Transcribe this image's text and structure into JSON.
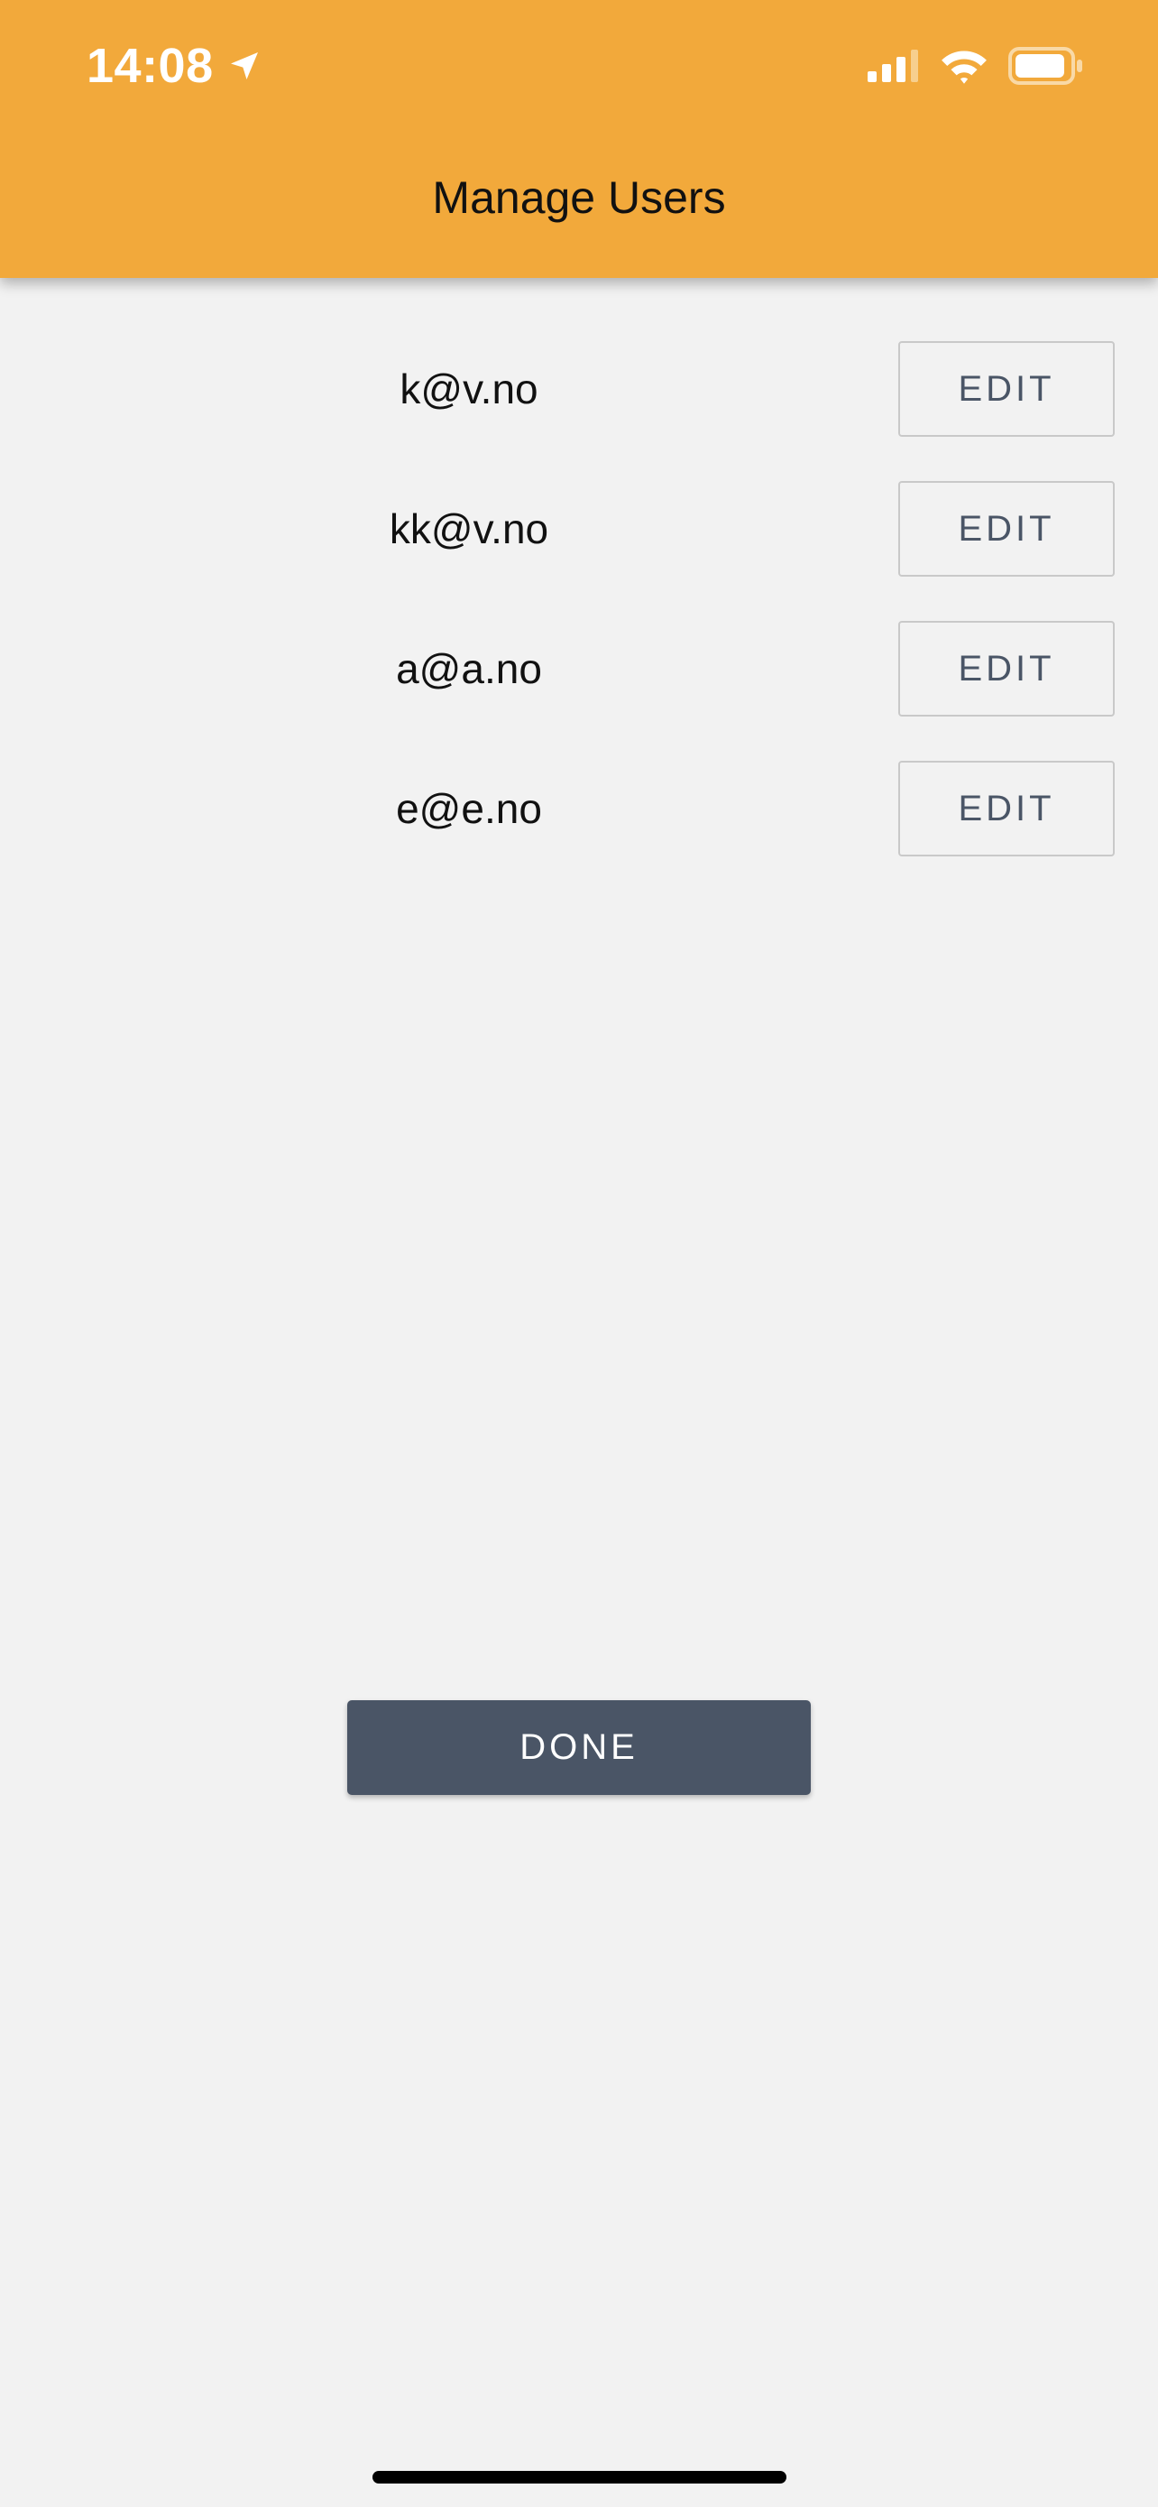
{
  "status_bar": {
    "time": "14:08",
    "icons": [
      "location-arrow-icon",
      "cellular-signal-icon",
      "wifi-icon",
      "battery-icon"
    ]
  },
  "header": {
    "title": "Manage Users",
    "background_color": "#f2a93b"
  },
  "users": [
    {
      "email": "k@v.no",
      "action_label": "EDIT"
    },
    {
      "email": "kk@v.no",
      "action_label": "EDIT"
    },
    {
      "email": "a@a.no",
      "action_label": "EDIT"
    },
    {
      "email": "e@e.no",
      "action_label": "EDIT"
    }
  ],
  "footer": {
    "done_label": "DONE",
    "done_color": "#4a5566"
  }
}
